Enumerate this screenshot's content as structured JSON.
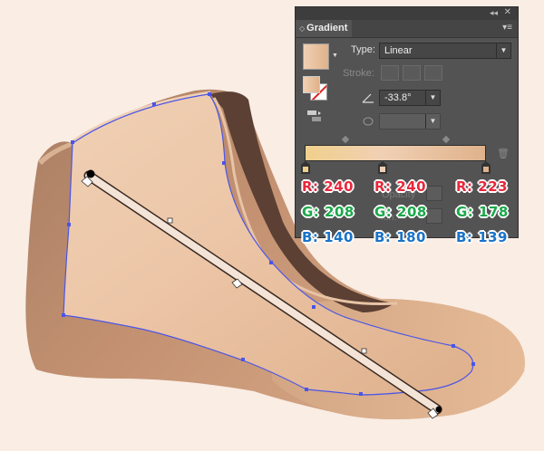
{
  "panel": {
    "title": "Gradient",
    "type_label": "Type:",
    "type_value": "Linear",
    "stroke_label": "Stroke:",
    "angle_value": "-33.8°",
    "aspect_value": "",
    "ramp_colors": [
      "#f0d0b4",
      "#dfb28b"
    ],
    "ghost_opacity": "Opacity",
    "ghost_location": "ion:"
  },
  "stops": [
    {
      "r_label": "R: 240",
      "g_label": "G: 208",
      "b_label": "B: 140"
    },
    {
      "r_label": "R: 240",
      "g_label": "G: 208",
      "b_label": "B: 180"
    },
    {
      "r_label": "R: 223",
      "g_label": "G: 178",
      "b_label": "B: 139"
    }
  ],
  "colors": {
    "background": "#f9ede4",
    "r_text": "#e8283c",
    "g_text": "#1ba84a",
    "b_text": "#1a73c8",
    "path_selection": "#4a55e8",
    "shoe_dark": "#5c4034",
    "shoe_side": "#b3866a"
  }
}
